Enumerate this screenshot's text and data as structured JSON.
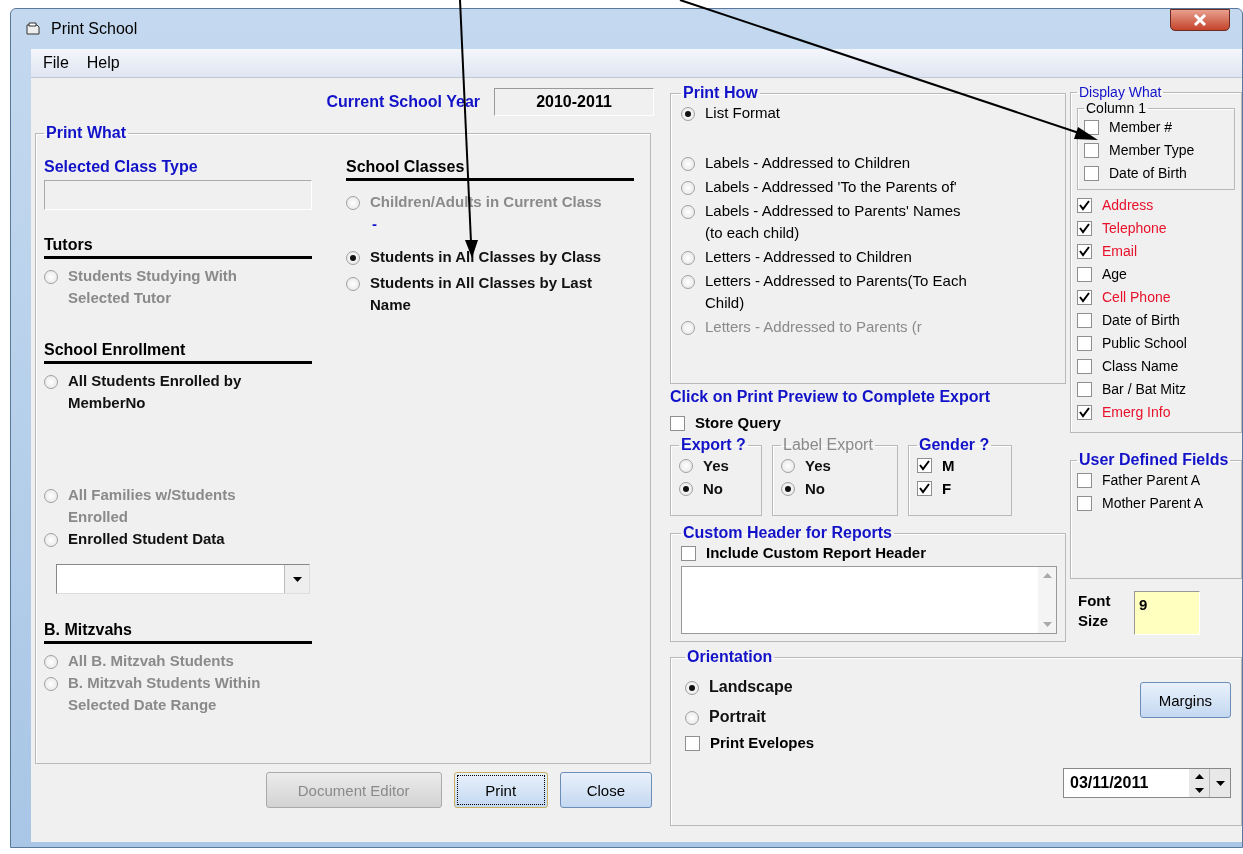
{
  "window": {
    "title": "Print School"
  },
  "menu": [
    "File",
    "Help"
  ],
  "school_year": {
    "label": "Current School Year",
    "value": "2010-2011"
  },
  "print_what": {
    "title": "Print What",
    "class_type": {
      "label": "Selected Class Type"
    },
    "left_sections": [
      {
        "heading": "Tutors",
        "options": [
          {
            "label": "Students Studying With Selected Tutor",
            "selected": false,
            "disabled": true
          }
        ]
      },
      {
        "heading": "School Enrollment",
        "options": [
          {
            "label": "All Students Enrolled by MemberNo",
            "selected": false,
            "disabled": false
          },
          {
            "label": "All Families w/Students Enrolled",
            "selected": false,
            "disabled": true
          },
          {
            "label": "Enrolled Student Data",
            "selected": false,
            "disabled": false
          }
        ],
        "dropdown": {
          "kind": "dropdown"
        }
      },
      {
        "heading": "B. Mitzvahs",
        "options": [
          {
            "label": "All B. Mitzvah Students",
            "selected": false,
            "disabled": true
          },
          {
            "label": "B. Mitzvah Students Within Selected Date Range",
            "selected": false,
            "disabled": true
          }
        ]
      }
    ],
    "school_classes": {
      "heading": "School Classes",
      "items": [
        {
          "kind": "radio",
          "label": "Children/Adults in Current Class",
          "selected": false,
          "disabled": true
        },
        {
          "kind": "note",
          "label": "-"
        },
        {
          "kind": "radio",
          "label": "Students in All Classes by Class",
          "selected": true,
          "disabled": false
        },
        {
          "kind": "radio",
          "label": "Students in All Classes by Last Name",
          "selected": false,
          "disabled": false
        }
      ]
    }
  },
  "buttons": [
    {
      "label": "Document Editor",
      "disabled": true,
      "focused": false
    },
    {
      "label": "Print",
      "disabled": false,
      "focused": true
    },
    {
      "label": "Close",
      "disabled": false,
      "focused": false
    }
  ],
  "print_how": {
    "title": "Print How",
    "options": [
      {
        "label": "List Format",
        "selected": true,
        "disabled": false
      },
      {
        "label": "Labels - Addressed to Children",
        "selected": false,
        "disabled": false
      },
      {
        "label": "Labels - Addressed 'To the Parents of'",
        "selected": false,
        "disabled": false
      },
      {
        "label": "Labels - Addressed to Parents' Names (to each child)",
        "selected": false,
        "disabled": false
      },
      {
        "label": "Letters - Addressed to Children",
        "selected": false,
        "disabled": false
      },
      {
        "label": "Letters - Addressed to Parents(To Each Child)",
        "selected": false,
        "disabled": false
      },
      {
        "label": "Letters - Addressed to Parents (r",
        "selected": false,
        "disabled": true
      }
    ]
  },
  "export_note": "Click on Print Preview to Complete Export",
  "store_query": {
    "label": "Store Query",
    "checked": false
  },
  "small_groups": [
    {
      "title": "Export ?",
      "kind": "radio",
      "disabled": false,
      "items": [
        {
          "label": "Yes",
          "selected": false
        },
        {
          "label": "No",
          "selected": true
        }
      ]
    },
    {
      "title": "Label Export",
      "kind": "radio",
      "disabled": true,
      "items": [
        {
          "label": "Yes",
          "selected": false
        },
        {
          "label": "No",
          "selected": true
        }
      ]
    },
    {
      "title": "Gender ?",
      "kind": "checkbox",
      "disabled": false,
      "items": [
        {
          "label": "M",
          "checked": true
        },
        {
          "label": "F",
          "checked": true
        }
      ]
    }
  ],
  "custom_header": {
    "title": "Custom Header for Reports",
    "checkbox": {
      "label": "Include Custom Report Header",
      "checked": false
    }
  },
  "display_what": {
    "title": "Display What",
    "column_1": {
      "title": "Column 1",
      "items": [
        {
          "label": "Member #",
          "checked": false
        },
        {
          "label": "Member Type",
          "checked": false
        },
        {
          "label": "Date of Birth",
          "checked": false
        }
      ]
    },
    "items": [
      {
        "label": "Address",
        "checked": true
      },
      {
        "label": "Telephone",
        "checked": true
      },
      {
        "label": "Email",
        "checked": true
      },
      {
        "label": "Age",
        "checked": false
      },
      {
        "label": "Cell Phone",
        "checked": true
      },
      {
        "label": "Date of Birth",
        "checked": false
      },
      {
        "label": "Public School",
        "checked": false
      },
      {
        "label": "Class Name",
        "checked": false
      },
      {
        "label": "Bar / Bat Mitz",
        "checked": false
      },
      {
        "label": "Emerg Info",
        "checked": true
      }
    ]
  },
  "user_defined": {
    "title": "User Defined Fields",
    "items": [
      {
        "label": "Father Parent A",
        "checked": false
      },
      {
        "label": "Mother Parent A",
        "checked": false
      }
    ]
  },
  "font_size": {
    "label": "Font Size",
    "value": "9"
  },
  "orientation": {
    "title": "Orientation",
    "options": [
      {
        "label": "Landscape",
        "selected": true
      },
      {
        "label": "Portrait",
        "selected": false
      }
    ],
    "envelopes": {
      "label": "Print Evelopes",
      "checked": false
    },
    "margins_button": "Margins",
    "date": "03/11/2011"
  }
}
